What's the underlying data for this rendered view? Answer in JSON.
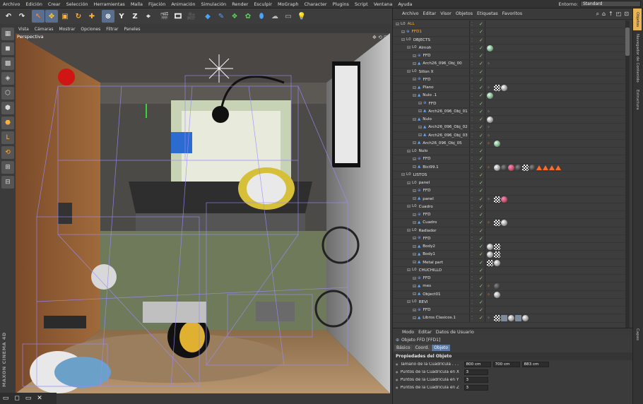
{
  "menubar": {
    "items": [
      "Archivo",
      "Edición",
      "Crear",
      "Selección",
      "Herramientas",
      "Malla",
      "Fijación",
      "Animación",
      "Simulación",
      "Render",
      "Esculpir",
      "MoGraph",
      "Character",
      "Plugins",
      "Script",
      "Ventana",
      "Ayuda"
    ],
    "layout_label": "Entorno:",
    "layout_value": "Standard"
  },
  "viewport": {
    "menu": [
      "Vista",
      "Cámaras",
      "Mostrar",
      "Opciones",
      "Filtrar",
      "Paneles"
    ],
    "label": "Perspectiva"
  },
  "brand": "MAXON CINEMA 4D",
  "object_manager": {
    "menu": [
      "Archivo",
      "Editar",
      "Visor",
      "Objetos",
      "Etiquetas",
      "Favoritos"
    ],
    "rows": [
      {
        "name": "ALL",
        "depth": 0,
        "style": "hl",
        "tags": []
      },
      {
        "name": "FFD1",
        "depth": 1,
        "style": "hl",
        "tags": []
      },
      {
        "name": "OBJECTS",
        "depth": 1,
        "style": "",
        "tags": []
      },
      {
        "name": "Almoh",
        "depth": 2,
        "style": "",
        "tags": [
          "sph-g"
        ]
      },
      {
        "name": "FFD",
        "depth": 3,
        "style": "",
        "tags": []
      },
      {
        "name": "Arch26_096_Obj_00",
        "depth": 3,
        "style": "",
        "tags": [
          "dot"
        ]
      },
      {
        "name": "Sillon X",
        "depth": 2,
        "style": "",
        "tags": []
      },
      {
        "name": "FFD",
        "depth": 3,
        "style": "",
        "tags": []
      },
      {
        "name": "Plano",
        "depth": 3,
        "style": "",
        "tags": [
          "dot",
          "chk",
          "sph-w"
        ]
      },
      {
        "name": "Nulo .1",
        "depth": 3,
        "style": "",
        "tags": [
          "sph-g"
        ]
      },
      {
        "name": "FFD",
        "depth": 4,
        "style": "",
        "tags": []
      },
      {
        "name": "Arch26_096_Obj_01",
        "depth": 4,
        "style": "",
        "tags": [
          "dot"
        ]
      },
      {
        "name": "Nulo",
        "depth": 3,
        "style": "",
        "tags": [
          "sph-w"
        ]
      },
      {
        "name": "Arch26_096_Obj_02",
        "depth": 4,
        "style": "",
        "tags": [
          "dot"
        ]
      },
      {
        "name": "Arch26_096_Obj_03",
        "depth": 4,
        "style": "",
        "tags": [
          "dot"
        ]
      },
      {
        "name": "Arch26_096_Obj_05",
        "depth": 3,
        "style": "",
        "tags": [
          "dot",
          "sph-g"
        ]
      },
      {
        "name": "Nulo",
        "depth": 2,
        "style": "",
        "tags": []
      },
      {
        "name": "FFD",
        "depth": 3,
        "style": "",
        "tags": []
      },
      {
        "name": "Bici99.1",
        "depth": 3,
        "style": "",
        "tags": [
          "dot",
          "sph-w",
          "sph-d",
          "sph-r",
          "sph-d",
          "chk",
          "sph-d",
          "tri",
          "tri",
          "tri",
          "tri"
        ]
      },
      {
        "name": "LISTOS",
        "depth": 1,
        "style": "",
        "tags": []
      },
      {
        "name": "panel",
        "depth": 2,
        "style": "",
        "tags": []
      },
      {
        "name": "FFD",
        "depth": 3,
        "style": "",
        "tags": []
      },
      {
        "name": "panel",
        "depth": 3,
        "style": "",
        "tags": [
          "dot",
          "chk",
          "sph-r"
        ]
      },
      {
        "name": "Cuadro",
        "depth": 2,
        "style": "",
        "tags": []
      },
      {
        "name": "FFD",
        "depth": 3,
        "style": "",
        "tags": []
      },
      {
        "name": "Cuadro",
        "depth": 3,
        "style": "",
        "tags": [
          "dot",
          "chk",
          "sph-w"
        ]
      },
      {
        "name": "Radiador",
        "depth": 2,
        "style": "",
        "tags": []
      },
      {
        "name": "FFD",
        "depth": 3,
        "style": "",
        "tags": []
      },
      {
        "name": "Body2",
        "depth": 3,
        "style": "",
        "tags": [
          "sph-w",
          "chk"
        ]
      },
      {
        "name": "Body1",
        "depth": 3,
        "style": "",
        "tags": [
          "sph-w",
          "chk"
        ]
      },
      {
        "name": "Metal part",
        "depth": 3,
        "style": "",
        "tags": [
          "chk",
          "sph-w"
        ]
      },
      {
        "name": "CHUCHILLO",
        "depth": 2,
        "style": "",
        "tags": []
      },
      {
        "name": "FFD",
        "depth": 3,
        "style": "",
        "tags": []
      },
      {
        "name": "mes",
        "depth": 3,
        "style": "",
        "tags": [
          "dot",
          "sph-d"
        ]
      },
      {
        "name": "Object01",
        "depth": 3,
        "style": "",
        "tags": [
          "dot",
          "sph-w"
        ]
      },
      {
        "name": "REVI",
        "depth": 2,
        "style": "",
        "tags": []
      },
      {
        "name": "FFD",
        "depth": 3,
        "style": "",
        "tags": []
      },
      {
        "name": "Libros Clasicos.1",
        "depth": 3,
        "style": "",
        "tags": [
          "dot",
          "chk",
          "sq",
          "sph-w",
          "sq",
          "sph-w"
        ]
      }
    ]
  },
  "attribute_manager": {
    "menu": [
      "Modo",
      "Editar",
      "Datos de Usuario"
    ],
    "title": "Objeto FFD [FFD1]",
    "tabs": [
      "Básico",
      "Coord.",
      "Objeto"
    ],
    "section": "Propiedades del Objeto",
    "fields": [
      {
        "label": "Tamaño de la Cuadrícula . . .",
        "values": [
          "800 cm",
          "700 cm",
          "883 cm"
        ]
      },
      {
        "label": "Puntos de la Cuadrícula en X",
        "values": [
          "3"
        ]
      },
      {
        "label": "Puntos de la Cuadrícula en Y",
        "values": [
          "3"
        ]
      },
      {
        "label": "Puntos de la Cuadrícula en Z",
        "values": [
          "3"
        ]
      }
    ]
  },
  "side_tabs": [
    "Objetos",
    "Navegador de Contenido",
    "Estructura",
    "Capas"
  ],
  "colors": {
    "selected_tab": "#5d7aa3",
    "highlight_name": "#ffb040",
    "check": "#8bd16a",
    "tag_triangle": "#ff6a2a"
  }
}
